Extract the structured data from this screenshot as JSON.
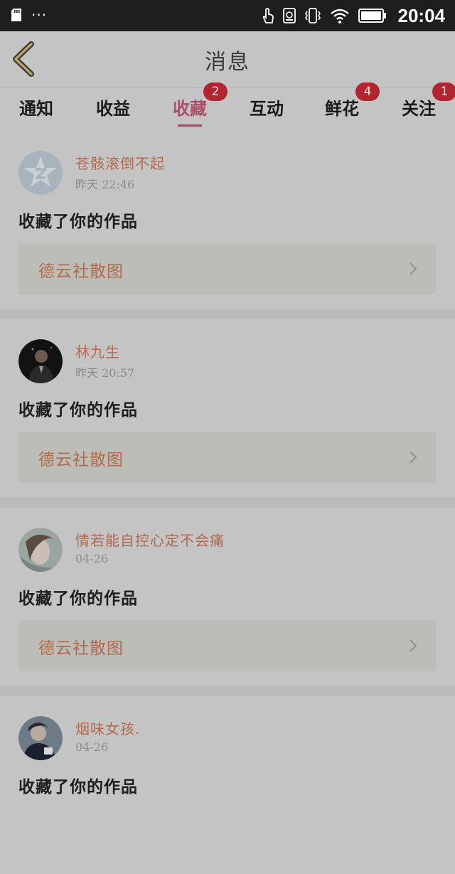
{
  "status_bar": {
    "time": "20:04",
    "dots": "···",
    "icons": [
      "sd-card-icon",
      "touch-icon",
      "storage-icon",
      "vibrate-icon",
      "wifi-icon",
      "battery-icon"
    ]
  },
  "header": {
    "title": "消息",
    "back_icon": "chevron-left-icon"
  },
  "tabs": [
    {
      "label": "通知",
      "badge": ""
    },
    {
      "label": "收益",
      "badge": ""
    },
    {
      "label": "收藏",
      "badge": "2",
      "active": true
    },
    {
      "label": "互动",
      "badge": ""
    },
    {
      "label": "鲜花",
      "badge": "4"
    },
    {
      "label": "关注",
      "badge": "1"
    }
  ],
  "messages": [
    {
      "name": "苍骸滚倒不起",
      "time": "昨天 22:46",
      "action": "收藏了你的作品",
      "work": "德云社散图",
      "avatar": "default-avatar"
    },
    {
      "name": "林九生",
      "time": "昨天 20:57",
      "action": "收藏了你的作品",
      "work": "德云社散图",
      "avatar": "photo-avatar"
    },
    {
      "name": "情若能自控心定不会痛",
      "time": "04-26",
      "action": "收藏了你的作品",
      "work": "德云社散图",
      "avatar": "photo-avatar"
    },
    {
      "name": "烟味女孩.",
      "time": "04-26",
      "action": "收藏了你的作品",
      "work": "",
      "avatar": "photo-avatar"
    }
  ],
  "colors": {
    "accent": "#b04466",
    "name": "#b46a4c",
    "badge": "#b22430",
    "overlay_bg": "#c4c4c4"
  }
}
